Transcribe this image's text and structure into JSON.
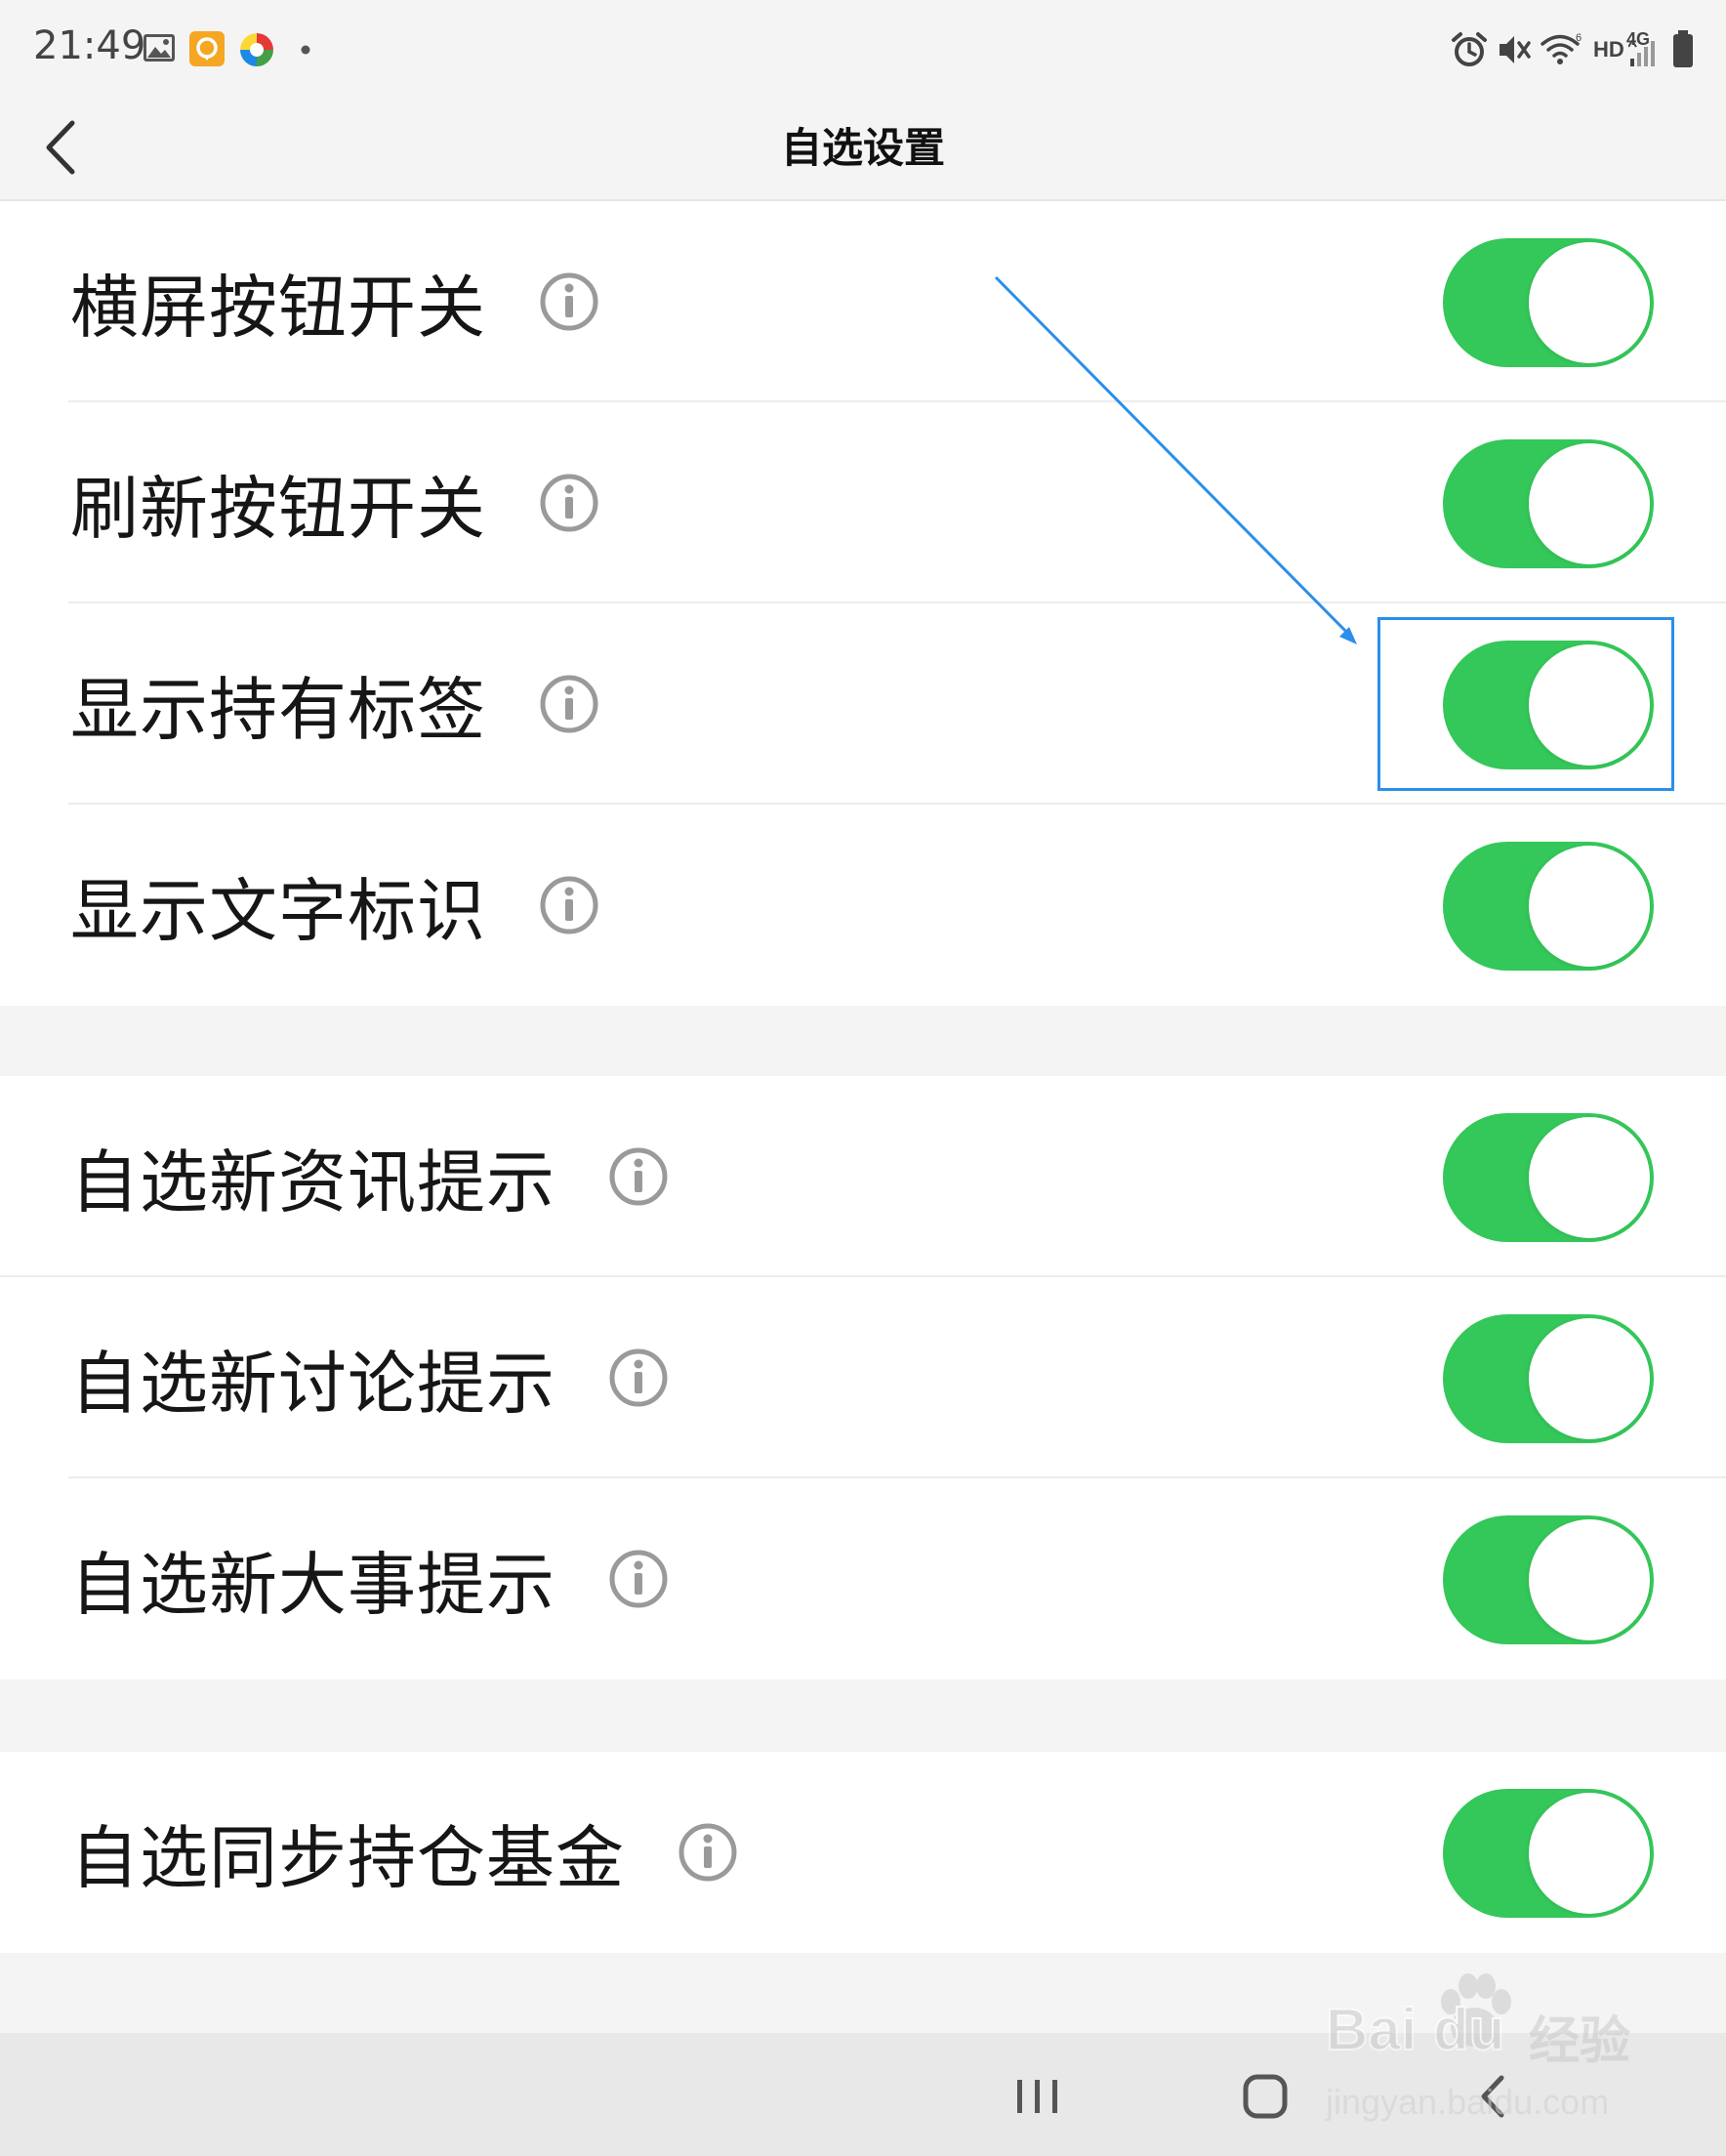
{
  "status_bar": {
    "time": "21:49",
    "network_hd": "HD",
    "network_4g": "4G",
    "left_icons": [
      "gallery-icon",
      "notification-app-icon",
      "colorful-app-icon",
      "more-dot-icon"
    ],
    "right_icons": [
      "alarm-icon",
      "mute-icon",
      "wifi-icon",
      "signal-icon",
      "battery-icon"
    ]
  },
  "nav": {
    "title": "自选设置",
    "back_icon": "chevron-left-icon"
  },
  "sections": [
    {
      "rows": [
        {
          "label": "横屏按钮开关",
          "toggle_on": true
        },
        {
          "label": "刷新按钮开关",
          "toggle_on": true
        },
        {
          "label": "显示持有标签",
          "toggle_on": true,
          "highlighted": true
        },
        {
          "label": "显示文字标识",
          "toggle_on": true
        }
      ]
    },
    {
      "rows": [
        {
          "label": "自选新资讯提示",
          "toggle_on": true
        },
        {
          "label": "自选新讨论提示",
          "toggle_on": true
        },
        {
          "label": "自选新大事提示",
          "toggle_on": true
        }
      ]
    },
    {
      "rows": [
        {
          "label": "自选同步持仓基金",
          "toggle_on": true
        }
      ]
    }
  ],
  "colors": {
    "toggle_on": "#34c759",
    "annotation": "#2a8fea",
    "background": "#f4f4f4"
  },
  "bottom_nav": {
    "icons": [
      "recent-apps-icon",
      "home-icon",
      "back-icon"
    ]
  },
  "watermark": {
    "brand": "Bai du",
    "brand_cn": "经验",
    "url": "jingyan.baidu.com"
  }
}
